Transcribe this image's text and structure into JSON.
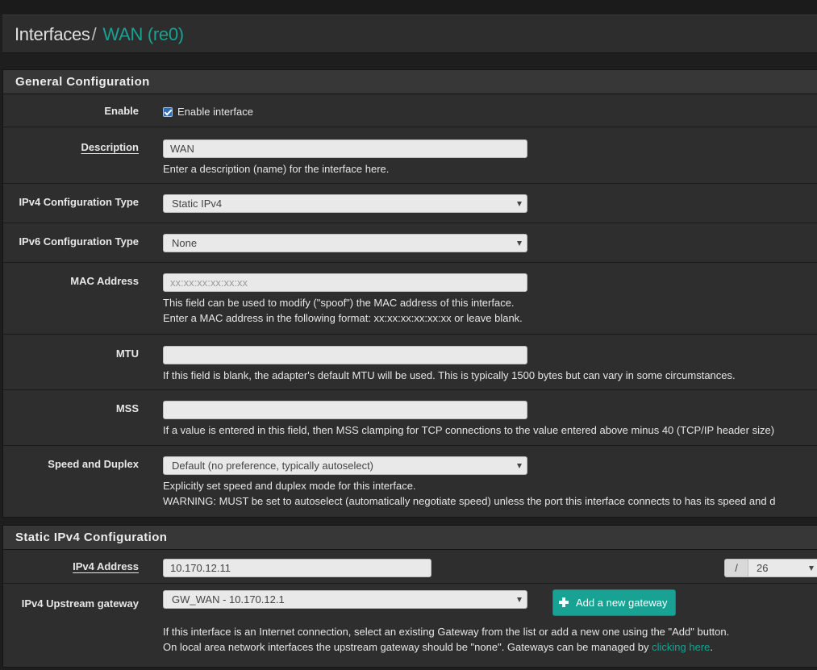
{
  "breadcrumb": {
    "root": "Interfaces",
    "separator": "/",
    "current": "WAN (re0)"
  },
  "general": {
    "heading": "General Configuration",
    "enable": {
      "label": "Enable",
      "checkbox_label": "Enable interface",
      "checked": true
    },
    "description": {
      "label": "Description",
      "value": "WAN",
      "help": "Enter a description (name) for the interface here."
    },
    "ipv4_type": {
      "label": "IPv4 Configuration Type",
      "selected": "Static IPv4"
    },
    "ipv6_type": {
      "label": "IPv6 Configuration Type",
      "selected": "None"
    },
    "mac": {
      "label": "MAC Address",
      "placeholder": "xx:xx:xx:xx:xx:xx",
      "value": "",
      "help1": "This field can be used to modify (\"spoof\") the MAC address of this interface.",
      "help2": "Enter a MAC address in the following format: xx:xx:xx:xx:xx:xx or leave blank."
    },
    "mtu": {
      "label": "MTU",
      "value": "",
      "help": "If this field is blank, the adapter's default MTU will be used. This is typically 1500 bytes but can vary in some circumstances."
    },
    "mss": {
      "label": "MSS",
      "value": "",
      "help": "If a value is entered in this field, then MSS clamping for TCP connections to the value entered above minus 40 (TCP/IP header size)"
    },
    "speed": {
      "label": "Speed and Duplex",
      "selected": "Default (no preference, typically autoselect)",
      "help1": "Explicitly set speed and duplex mode for this interface.",
      "help2": "WARNING: MUST be set to autoselect (automatically negotiate speed) unless the port this interface connects to has its speed and d"
    }
  },
  "static_ipv4": {
    "heading": "Static IPv4 Configuration",
    "address": {
      "label": "IPv4 Address",
      "value": "10.170.12.11",
      "slash": "/",
      "cidr": "26"
    },
    "gateway": {
      "label": "IPv4 Upstream gateway",
      "selected": "GW_WAN - 10.170.12.1",
      "add_button": "Add a new gateway",
      "help1": "If this interface is an Internet connection, select an existing Gateway from the list or add a new one using the \"Add\" button.",
      "help2_prefix": "On local area network interfaces the upstream gateway should be \"none\". Gateways can be managed by ",
      "help2_link": "clicking here",
      "help2_suffix": "."
    }
  },
  "icons": {
    "checkbox": "checkbox-checked-icon",
    "dropdown": "chevron-down-icon",
    "add": "plus-icon"
  },
  "colors": {
    "accent": "#17a293",
    "background": "#1e1e1e",
    "panel": "#2e2e2e",
    "panel_heading": "#373737",
    "checkbox": "#2d6fb8"
  }
}
